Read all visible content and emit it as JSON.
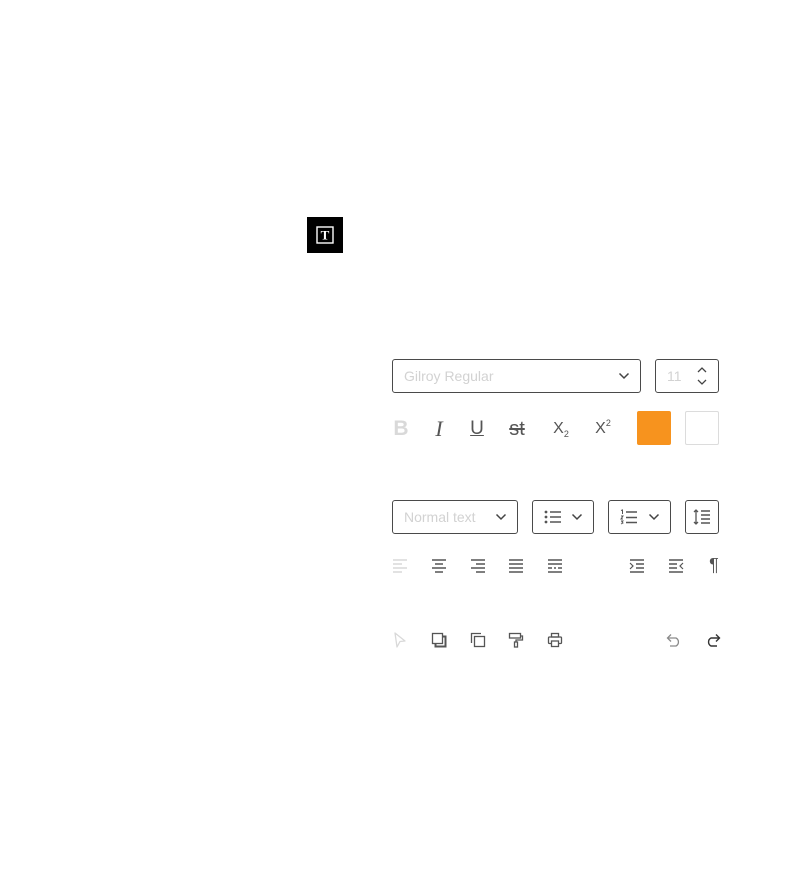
{
  "text_tool": {
    "label": "T"
  },
  "font": {
    "family": "Gilroy Regular",
    "size": "11"
  },
  "format": {
    "bold": "B",
    "italic": "I",
    "underline": "U",
    "strike": "st",
    "subscript": "X",
    "subscript_mark": "2",
    "superscript": "X",
    "superscript_mark": "2",
    "text_color": "#F7931E",
    "highlight_color": "#FFFFFF"
  },
  "paragraph": {
    "style": "Normal text"
  },
  "colors": {
    "disabled": "#d5d5d5",
    "icon": "#5a5a5a",
    "border": "#4a4a4a"
  }
}
